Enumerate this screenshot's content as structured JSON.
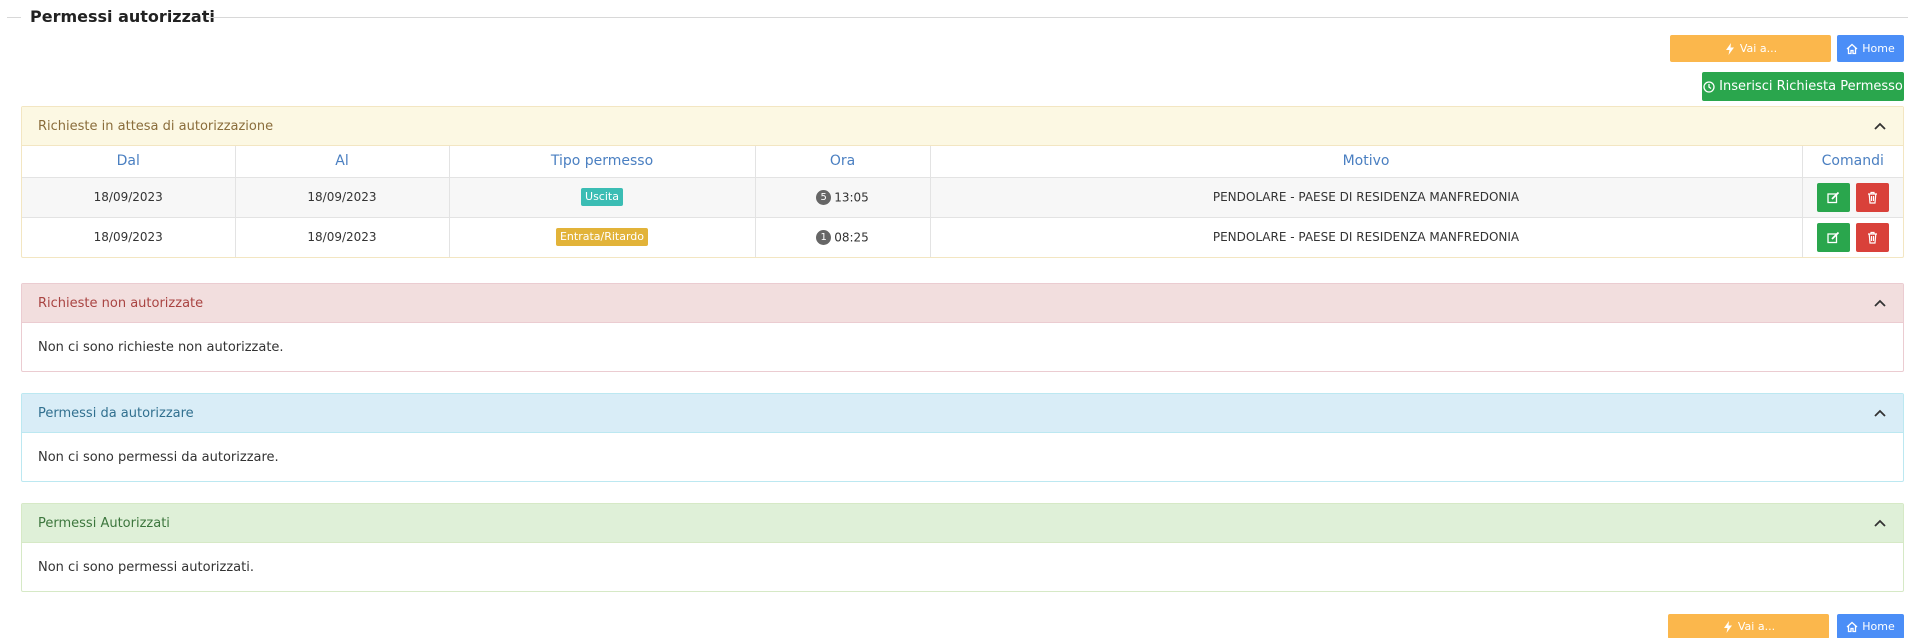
{
  "page": {
    "title": "Permessi autorizzati"
  },
  "toolbar": {
    "goto_label": "Vai a...",
    "home_label": "Home",
    "insert_label": "Inserisci Richiesta Permesso"
  },
  "pending": {
    "heading": "Richieste in attesa di autorizzazione",
    "columns": [
      "Dal",
      "Al",
      "Tipo permesso",
      "Ora",
      "Motivo",
      "Comandi"
    ],
    "rows": [
      {
        "dal": "18/09/2023",
        "al": "18/09/2023",
        "tipo": "Uscita",
        "badge": "5",
        "ora": "13:05",
        "motivo": "PENDOLARE - PAESE DI RESIDENZA MANFREDONIA"
      },
      {
        "dal": "18/09/2023",
        "al": "18/09/2023",
        "tipo": "Entrata/Ritardo",
        "badge": "1",
        "ora": "08:25",
        "motivo": "PENDOLARE - PAESE DI RESIDENZA MANFREDONIA"
      }
    ]
  },
  "rejected": {
    "heading": "Richieste non autorizzate",
    "empty": "Non ci sono richieste non autorizzate."
  },
  "to_authorize": {
    "heading": "Permessi da autorizzare",
    "empty": "Non ci sono permessi da autorizzare."
  },
  "authorized": {
    "heading": "Permessi Autorizzati",
    "empty": "Non ci sono permessi autorizzati."
  },
  "colors": {
    "warning_btn": "#fbb74c",
    "primary_btn": "#4b8ef7",
    "success_btn": "#2aa64d",
    "danger_btn": "#d9413a",
    "header_link": "#4a7fc1"
  },
  "icons": {
    "goto": "bolt-icon",
    "home": "home-icon",
    "insert": "clock-icon",
    "collapse": "chevron-up-icon",
    "edit": "edit-icon",
    "delete": "trash-icon"
  }
}
